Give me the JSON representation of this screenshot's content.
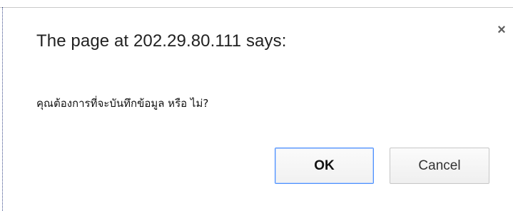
{
  "dialog": {
    "title": "The page at 202.29.80.111 says:",
    "message": "คุณต้องการที่จะบันทึกข้อมูล หรือ ไม่?",
    "close_glyph": "×",
    "ok_label": "OK",
    "cancel_label": "Cancel"
  },
  "colors": {
    "ok_border": "#4d90fe",
    "cancel_border": "#c6c6c6",
    "text": "#222222"
  }
}
